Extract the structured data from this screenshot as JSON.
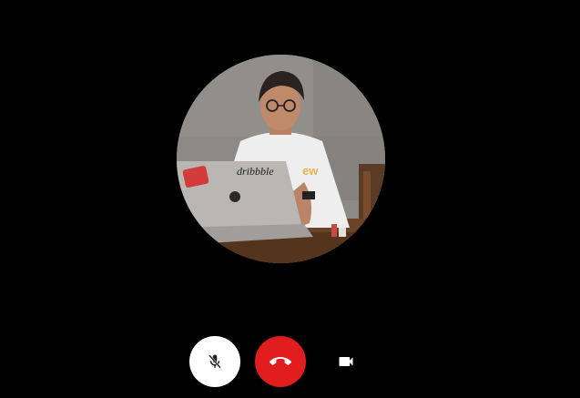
{
  "call": {
    "avatar": {
      "sticker_text": "dribbble",
      "shirt_text": "ew"
    },
    "controls": {
      "mute_icon": "mic-off-icon",
      "end_call_icon": "phone-hangup-icon",
      "video_icon": "videocam-icon"
    },
    "colors": {
      "background": "#000000",
      "mute_button": "#ffffff",
      "end_call_button": "#e11d1d",
      "video_icon": "#ffffff"
    }
  }
}
